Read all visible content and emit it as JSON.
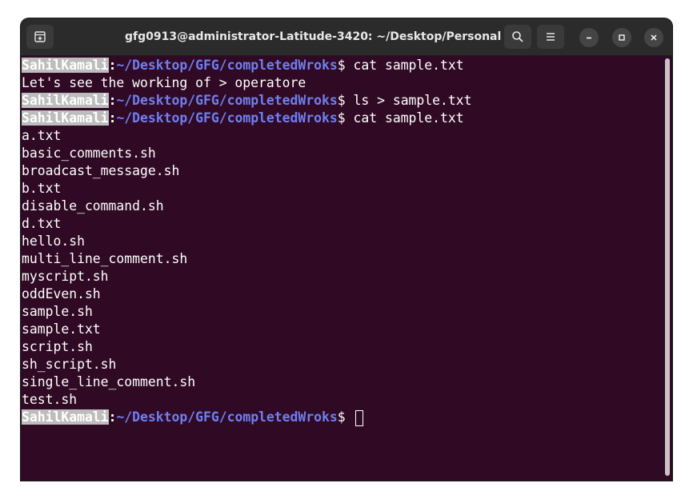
{
  "window": {
    "title": "gfg0913@administrator-Latitude-3420: ~/Desktop/Personal"
  },
  "icons": {
    "new_tab": "new-tab-icon",
    "search": "search-icon",
    "menu": "hamburger-menu-icon",
    "minimize": "minimize-icon",
    "maximize": "maximize-icon",
    "close": "close-icon"
  },
  "colors": {
    "terminal_bg": "#300a24",
    "path": "#6f7ff2",
    "titlebar": "#2b2b2b"
  },
  "terminal": {
    "prompt_user": "SahilKamali",
    "prompt_path": "~/Desktop/GFG/completedWroks",
    "commands": [
      "$ cat sample.txt",
      "$ ls > sample.txt",
      "$ cat sample.txt",
      "$ "
    ],
    "output1": "Let's see the working of > operatore",
    "files": [
      "a.txt",
      "basic_comments.sh",
      "broadcast_message.sh",
      "b.txt",
      "disable_command.sh",
      "d.txt",
      "hello.sh",
      "multi_line_comment.sh",
      "myscript.sh",
      "oddEven.sh",
      "sample.sh",
      "sample.txt",
      "script.sh",
      "sh_script.sh",
      "single_line_comment.sh",
      "test.sh"
    ]
  }
}
